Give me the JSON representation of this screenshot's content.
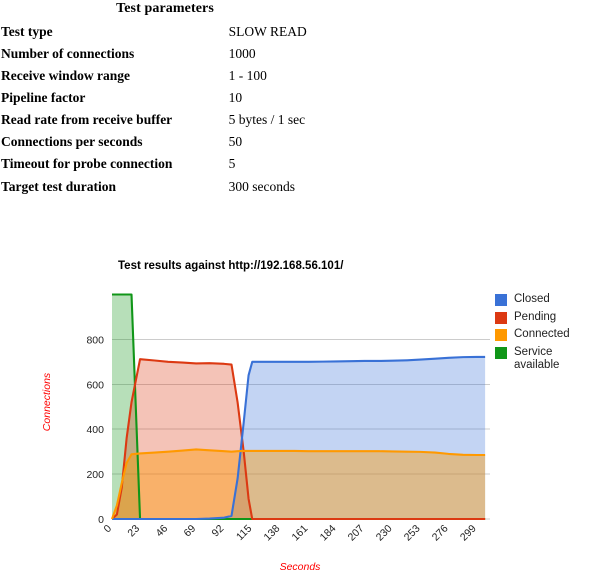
{
  "parameters": {
    "caption": "Test parameters",
    "rows": [
      {
        "key": "Test type",
        "value": "SLOW READ"
      },
      {
        "key": "Number of connections",
        "value": "1000"
      },
      {
        "key": "Receive window range",
        "value": "1 - 100"
      },
      {
        "key": "Pipeline factor",
        "value": "10"
      },
      {
        "key": "Read rate from receive buffer",
        "value": "5 bytes / 1 sec"
      },
      {
        "key": "Connections per seconds",
        "value": "50"
      },
      {
        "key": "Timeout for probe connection",
        "value": "5"
      },
      {
        "key": "Target test duration",
        "value": "300 seconds"
      }
    ]
  },
  "chart_data": {
    "type": "area",
    "title": "Test results against http://192.168.56.101/",
    "xlabel": "Seconds",
    "ylabel": "Connections",
    "x_tick_labels": [
      "0",
      "23",
      "46",
      "69",
      "92",
      "115",
      "138",
      "161",
      "184",
      "207",
      "230",
      "253",
      "276",
      "299"
    ],
    "y_tick_labels": [
      "0",
      "200",
      "400",
      "600",
      "800"
    ],
    "xlim": [
      0,
      310
    ],
    "ylim": [
      0,
      1020
    ],
    "grid": true,
    "legend_position": "right",
    "colors": {
      "closed": "#3971d6",
      "pending": "#dc3912",
      "connected": "#ff9900",
      "service_available": "#109618"
    },
    "x": [
      0,
      4,
      8,
      12,
      16,
      23,
      35,
      46,
      58,
      69,
      80,
      92,
      98,
      103,
      108,
      112,
      115,
      120,
      126,
      138,
      150,
      161,
      173,
      184,
      196,
      207,
      219,
      230,
      242,
      253,
      265,
      276,
      288,
      299,
      306
    ],
    "series": [
      {
        "name": "Closed",
        "color": "#3971d6",
        "values": [
          0,
          0,
          0,
          0,
          0,
          0,
          0,
          0,
          0,
          0,
          2,
          6,
          14,
          180,
          430,
          640,
          700,
          700,
          700,
          700,
          700,
          700,
          701,
          702,
          703,
          704,
          704,
          705,
          707,
          710,
          714,
          718,
          721,
          722,
          722
        ]
      },
      {
        "name": "Pending",
        "color": "#dc3912",
        "values": [
          0,
          20,
          140,
          360,
          520,
          712,
          706,
          700,
          697,
          693,
          694,
          691,
          688,
          520,
          300,
          90,
          0,
          0,
          0,
          0,
          0,
          0,
          0,
          0,
          0,
          0,
          0,
          0,
          0,
          0,
          0,
          0,
          0,
          0,
          0
        ]
      },
      {
        "name": "Connected",
        "color": "#ff9900",
        "values": [
          0,
          60,
          160,
          250,
          288,
          292,
          296,
          300,
          305,
          310,
          306,
          302,
          300,
          302,
          303,
          303,
          303,
          303,
          303,
          303,
          303,
          302,
          302,
          302,
          302,
          302,
          302,
          301,
          300,
          299,
          296,
          290,
          286,
          285,
          285
        ]
      },
      {
        "name": "Service available",
        "color": "#109618",
        "values": [
          1000,
          1000,
          1000,
          1000,
          1000,
          0,
          0,
          0,
          0,
          0,
          0,
          0,
          0,
          0,
          0,
          0,
          0,
          0,
          0,
          0,
          0,
          0,
          0,
          0,
          0,
          0,
          0,
          0,
          0,
          0,
          0,
          0,
          0,
          0,
          0
        ]
      }
    ],
    "legend": [
      {
        "label": "Closed",
        "color": "#3971d6"
      },
      {
        "label": "Pending",
        "color": "#dc3912"
      },
      {
        "label": "Connected",
        "color": "#ff9900"
      },
      {
        "label": "Service available",
        "color": "#109618"
      }
    ]
  }
}
